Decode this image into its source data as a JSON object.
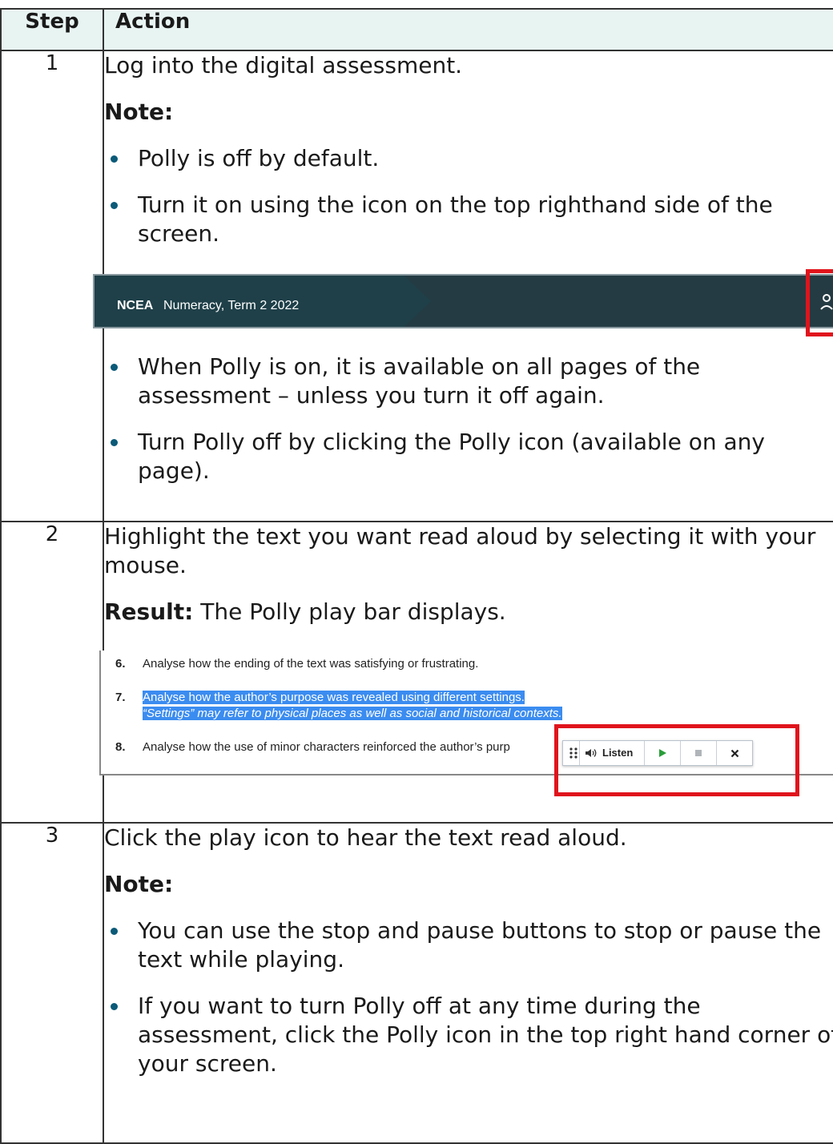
{
  "header": {
    "step": "Step",
    "action": "Action"
  },
  "rows": [
    {
      "step": "1",
      "text": "Log into the digital assessment.",
      "note_label": "Note:",
      "bullets": [
        "Polly is off by default.",
        "Turn it on using the icon on the top righthand side of the screen."
      ],
      "screenshot": {
        "brand": "NCEA",
        "title": "Numeracy, Term 2 2022",
        "icon": "polly-speaker-icon"
      },
      "bullets_after": [
        "When Polly is on, it is available on all pages of the assessment – unless you turn it off again.",
        "Turn Polly off by clicking the Polly icon (available on any page)."
      ]
    },
    {
      "step": "2",
      "text": "Highlight the text you want read aloud by selecting it with your mouse.",
      "result_label": "Result:",
      "result_text": " The Polly play bar displays.",
      "screenshot": {
        "questions": [
          {
            "num": "6.",
            "text": "Analyse how the ending of the text was satisfying or frustrating."
          },
          {
            "num": "7.",
            "text": "Analyse how the author’s purpose was revealed using different settings.",
            "text2": "“Settings” may refer to physical places as well as social and historical contexts."
          },
          {
            "num": "8.",
            "text": "Analyse how the use of minor characters reinforced the author’s purp"
          }
        ],
        "playbar": {
          "listen_label": "Listen"
        }
      }
    },
    {
      "step": "3",
      "text": "Click the play icon to hear the text read aloud.",
      "note_label": "Note:",
      "bullets": [
        "You can use the stop and pause buttons to stop or pause the text while playing.",
        "If you want to turn Polly off at any time during the assessment, click the Polly icon in the top right hand corner of your screen."
      ]
    }
  ],
  "colors": {
    "header_bg": "#e8f4f2",
    "bullet": "#0b5a78",
    "highlight_box": "#e0141c",
    "ncea_bar": "#243b43",
    "selection": "#3b8cf0",
    "play_green": "#2a9d3a"
  }
}
